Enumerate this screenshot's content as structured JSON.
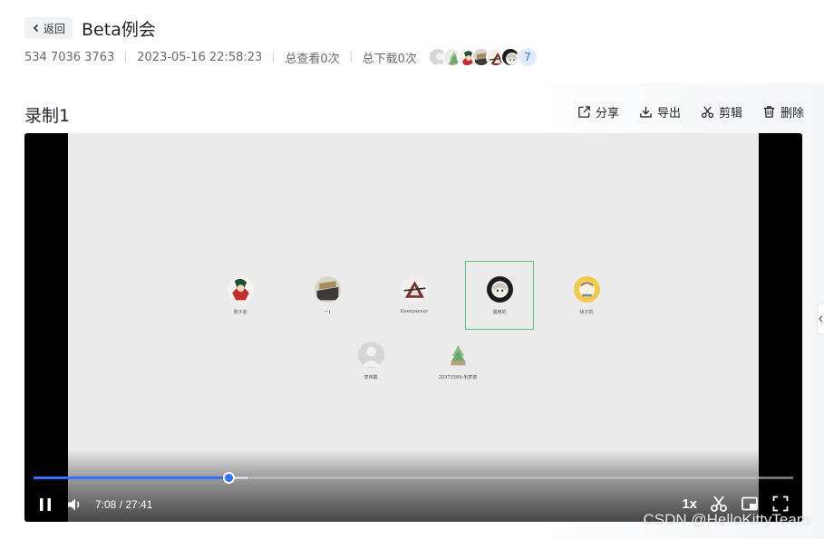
{
  "header": {
    "back_label": "返回",
    "title": "Beta例会"
  },
  "meta": {
    "meeting_id": "534 7036 3763",
    "datetime": "2023-05-16 22:58:23",
    "views": "总查看0次",
    "downloads": "总下载0次",
    "extra_participants": "7",
    "avatars": [
      "grey-avatar-icon",
      "plant-avatar-icon",
      "warrior-avatar-icon",
      "cat-avatar-icon",
      "character-avatar-icon",
      "anime-avatar-icon"
    ]
  },
  "recording": {
    "title": "录制1",
    "actions": {
      "share": "分享",
      "export": "导出",
      "edit": "剪辑",
      "delete": "删除"
    }
  },
  "player": {
    "current_time": "7:08",
    "total_time": "27:41",
    "time_sep": " / ",
    "progress_fraction": 0.256,
    "buffered_fraction": 0.282,
    "speed": "1x",
    "participants": [
      {
        "name": "景子道",
        "icon": "warrior-avatar-icon"
      },
      {
        "name": "一)",
        "icon": "cat-avatar-icon"
      },
      {
        "name": "Kaxeyaxxxx",
        "icon": "character-avatar-icon"
      },
      {
        "name": "晨用的",
        "icon": "anime-avatar-icon",
        "active": true
      },
      {
        "name": "徐子凯",
        "icon": "yellow-avatar-icon"
      },
      {
        "name": "李林鑫",
        "icon": "grey-avatar-icon"
      },
      {
        "name": "20373384-朱梦德",
        "icon": "plant-avatar-icon"
      }
    ]
  },
  "watermark": "CSDN @HelloKittyTeam",
  "colors": {
    "accent": "#3370ff",
    "active_border": "#5fbf7f"
  }
}
